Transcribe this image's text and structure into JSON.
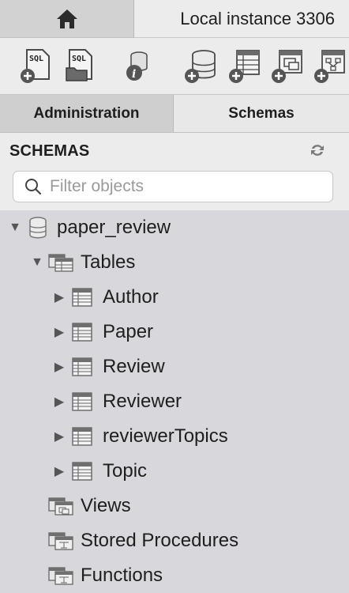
{
  "tabs": {
    "home_icon": "home-icon",
    "connection_title": "Local instance 3306"
  },
  "toolbar": {
    "buttons": [
      {
        "name": "new-sql-tab-icon"
      },
      {
        "name": "open-sql-script-icon"
      },
      {
        "name": "inspector-icon"
      },
      {
        "name": "create-schema-icon"
      },
      {
        "name": "create-table-icon"
      },
      {
        "name": "create-view-icon"
      },
      {
        "name": "create-routine-icon"
      }
    ],
    "sql_badge": "SQL"
  },
  "subtabs": {
    "administration": "Administration",
    "schemas": "Schemas"
  },
  "navigator": {
    "title": "SCHEMAS",
    "filter_placeholder": "Filter objects"
  },
  "tree": {
    "schema": "paper_review",
    "tables_label": "Tables",
    "tables": [
      "Author",
      "Paper",
      "Review",
      "Reviewer",
      "reviewerTopics",
      "Topic"
    ],
    "views_label": "Views",
    "procedures_label": "Stored Procedures",
    "functions_label": "Functions"
  },
  "colors": {
    "sidebar_bg": "#d8d7dc",
    "toolbar_bg": "#ececec",
    "icon_gray": "#5a5a5a"
  }
}
